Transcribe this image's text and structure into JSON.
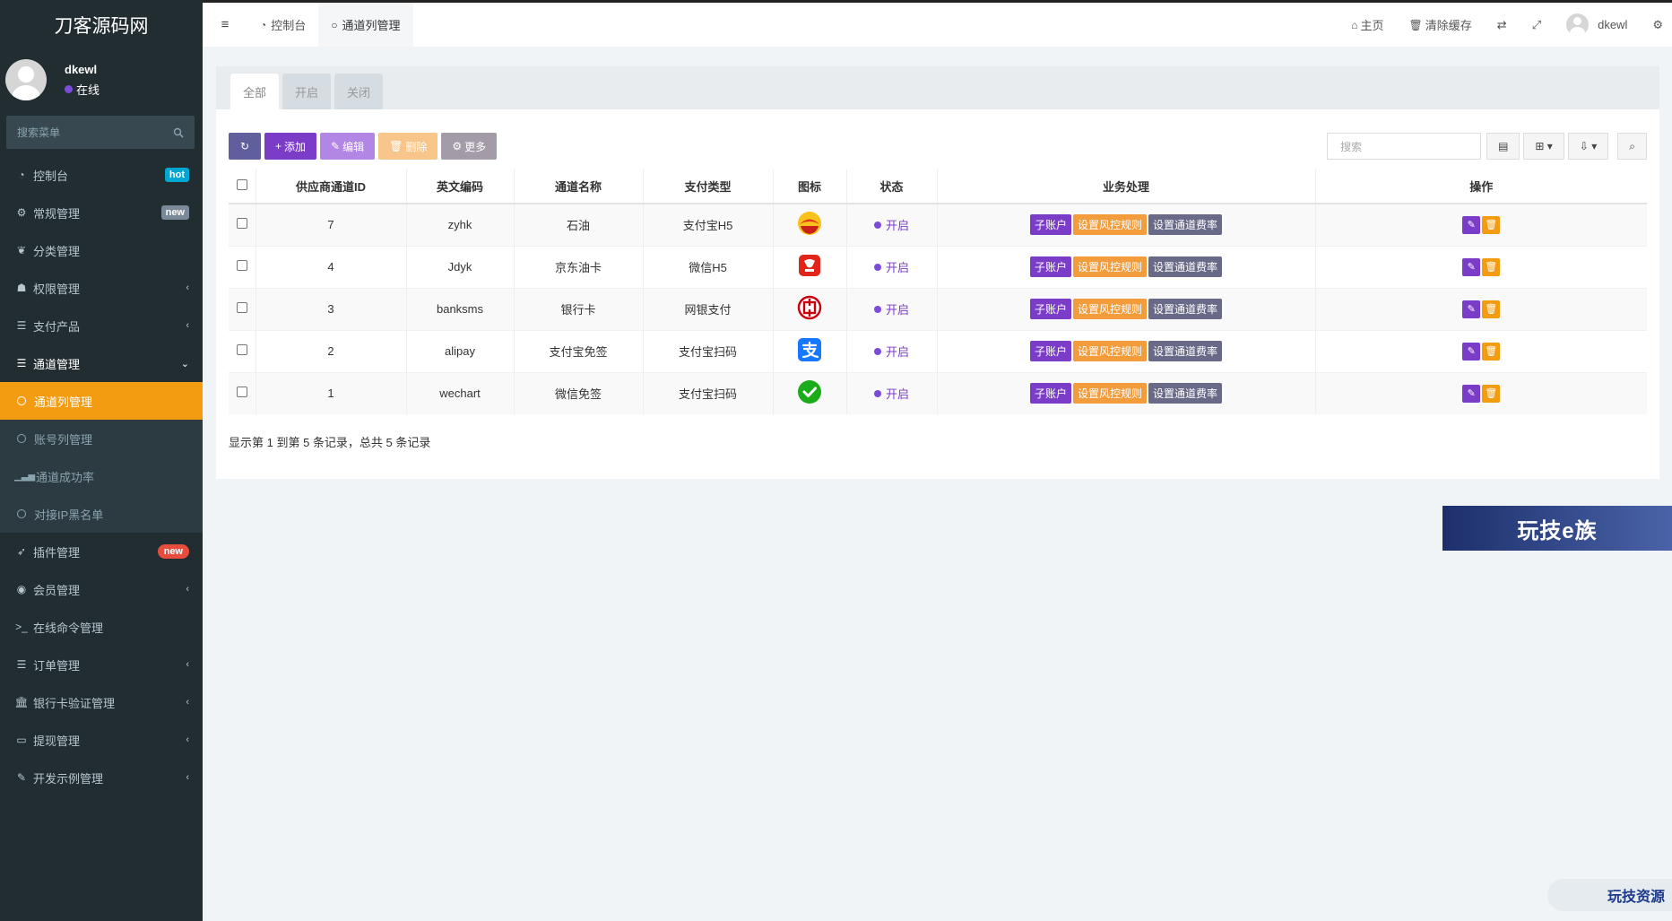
{
  "sidebar": {
    "logo": "刀客源码网",
    "user": {
      "name": "dkewl",
      "status": "在线"
    },
    "search_placeholder": "搜索菜单",
    "items": [
      {
        "label": "控制台",
        "badge": "hot"
      },
      {
        "label": "常规管理",
        "badge": "new"
      },
      {
        "label": "分类管理"
      },
      {
        "label": "权限管理"
      },
      {
        "label": "支付产品"
      },
      {
        "label": "通道管理"
      }
    ],
    "submenu": [
      {
        "label": "通道列管理"
      },
      {
        "label": "账号列管理"
      },
      {
        "label": "通道成功率"
      },
      {
        "label": "对接IP黑名单"
      }
    ],
    "items2": [
      {
        "label": "插件管理",
        "badge": "new"
      },
      {
        "label": "会员管理"
      },
      {
        "label": "在线命令管理"
      },
      {
        "label": "订单管理"
      },
      {
        "label": "银行卡验证管理"
      },
      {
        "label": "提现管理"
      },
      {
        "label": "开发示例管理"
      }
    ]
  },
  "topbar": {
    "tabs": [
      "控制台",
      "通道列管理"
    ],
    "home": "主页",
    "clear_cache": "清除缓存",
    "username": "dkewl"
  },
  "panel": {
    "tabs": [
      "全部",
      "开启",
      "关闭"
    ],
    "buttons": {
      "add": "添加",
      "edit": "编辑",
      "delete": "删除",
      "more": "更多"
    },
    "search_placeholder": "搜索",
    "columns": [
      "供应商通道ID",
      "英文编码",
      "通道名称",
      "支付类型",
      "图标",
      "状态",
      "业务处理",
      "操作"
    ],
    "rows": [
      {
        "id": "7",
        "code": "zyhk",
        "name": "石油",
        "type": "支付宝H5",
        "icon": "petrochina-icon",
        "status": "开启"
      },
      {
        "id": "4",
        "code": "Jdyk",
        "name": "京东油卡",
        "type": "微信H5",
        "icon": "jd-icon",
        "status": "开启"
      },
      {
        "id": "3",
        "code": "banksms",
        "name": "银行卡",
        "type": "网银支付",
        "icon": "icbc-icon",
        "status": "开启"
      },
      {
        "id": "2",
        "code": "alipay",
        "name": "支付宝免签",
        "type": "支付宝扫码",
        "icon": "alipay-icon",
        "status": "开启"
      },
      {
        "id": "1",
        "code": "wechart",
        "name": "微信免签",
        "type": "支付宝扫码",
        "icon": "wechat-icon",
        "status": "开启"
      }
    ],
    "ops": {
      "sub": "子账户",
      "risk": "设置风控规则",
      "rate": "设置通道费率"
    },
    "pager_text": "显示第 1 到第 5 条记录，总共 5 条记录"
  },
  "watermarks": {
    "top": "玩技e族",
    "bottom": "玩技资源"
  },
  "colors": {
    "sidebar_bg": "#222d32",
    "active_menu": "#f39c12",
    "primary": "#7b3dc8"
  }
}
